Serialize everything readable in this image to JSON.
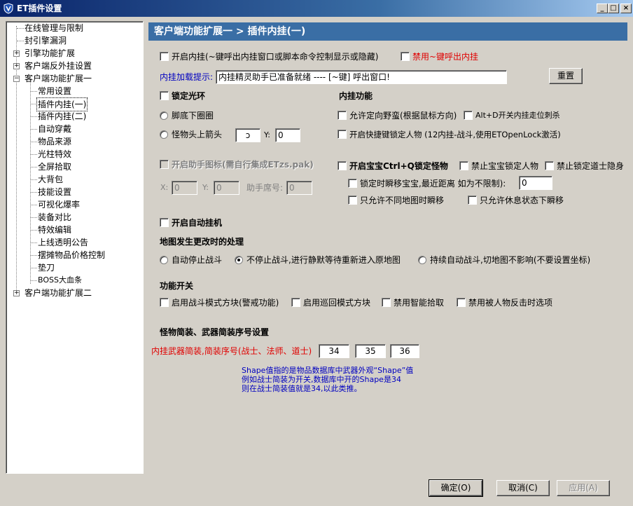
{
  "window": {
    "title": "ET插件设置",
    "min_label": "_",
    "max_label": "□",
    "close_label": "×"
  },
  "tree": {
    "items": [
      {
        "label": "在线管理与限制"
      },
      {
        "label": "封引擎漏洞"
      },
      {
        "label": "引擎功能扩展"
      },
      {
        "label": "客户端反外挂设置"
      },
      {
        "label": "客户端功能扩展一"
      },
      {
        "label": "常用设置"
      },
      {
        "label": "插件内挂(一)"
      },
      {
        "label": "插件内挂(二)"
      },
      {
        "label": "自动穿戴"
      },
      {
        "label": "物品来源"
      },
      {
        "label": "光柱特效"
      },
      {
        "label": "全屏拾取"
      },
      {
        "label": "大背包"
      },
      {
        "label": "技能设置"
      },
      {
        "label": "可视化爆率"
      },
      {
        "label": "装备对比"
      },
      {
        "label": "特效编辑"
      },
      {
        "label": "上线透明公告"
      },
      {
        "label": "摆摊物品价格控制"
      },
      {
        "label": "垫刀"
      },
      {
        "label": "BOSS大血条"
      },
      {
        "label": "客户端功能扩展二"
      }
    ]
  },
  "header": {
    "title": "客户端功能扩展一  >  插件内挂(一)"
  },
  "top": {
    "enable_label": "开启内挂(~键呼出内挂窗口或脚本命令控制显示或隐藏)",
    "ban_label": "禁用~键呼出内挂",
    "prompt_label": "内挂加载提示:",
    "prompt_value": "内挂精灵助手已准备就绪 ---- [~键] 呼出窗口!",
    "reset_label": "重置"
  },
  "lock_ring": {
    "title": "锁定光环",
    "foot_label": "脚底下圈圈",
    "head_label": "怪物头上箭头",
    "arrow_value": "ↄ",
    "y_label": "Y:",
    "y_value": "0"
  },
  "features": {
    "title": "内挂功能",
    "wild_label": "允许定向野蛮(根据鼠标方向)",
    "altd_label": "Alt+D开关内挂走位刺杀",
    "quicklock_label": "开启快捷键锁定人物 (12内挂-战斗,使用ETOpenLock激活)"
  },
  "helper": {
    "icon_label": "开启助手图标(需自行集成ETzs.pak)",
    "x_label": "X:",
    "x_value": "0",
    "y_label": "Y:",
    "y_value": "0",
    "seq_label": "助手席号:",
    "seq_value": "0"
  },
  "pet": {
    "lock_label": "开启宝宝Ctrl+Q锁定怪物",
    "no_lock_player_label": "禁止宝宝锁定人物",
    "no_lock_taoist_label": "禁止锁定道士隐身",
    "teleport_label": "锁定时瞬移宝宝,最近距离 如为不限制):",
    "teleport_value": "0",
    "diff_map_label": "只允许不同地图时瞬移",
    "rest_label": "只允许休息状态下瞬移"
  },
  "auto": {
    "label": "开启自动挂机"
  },
  "mapchange": {
    "title": "地图发生更改时的处理",
    "opt1": "自动停止战斗",
    "opt2": "不停止战斗,进行静默等待重新进入原地图",
    "opt3": "持续自动战斗,切地图不影响(不要设置坐标)"
  },
  "switches": {
    "title": "功能开关",
    "opt1": "启用战斗模式方块(警戒功能)",
    "opt2": "启用巡回模式方块",
    "opt3": "禁用智能拾取",
    "opt4": "禁用被人物反击时选项"
  },
  "weapon": {
    "title": "怪物简装、武器简装序号设置",
    "label": "内挂武器简装,简装序号(战士、法师、道士)",
    "v1": "34",
    "v2": "35",
    "v3": "36",
    "note1": "Shape值指的是物品数据库中武器外观“Shape”值",
    "note2": "例如战士简装为开关,数据库中开的Shape是34",
    "note3": "则在战士简装值就是34,以此类推。"
  },
  "buttons": {
    "ok": "确定(O)",
    "cancel": "取消(C)",
    "apply": "应用(A)"
  }
}
